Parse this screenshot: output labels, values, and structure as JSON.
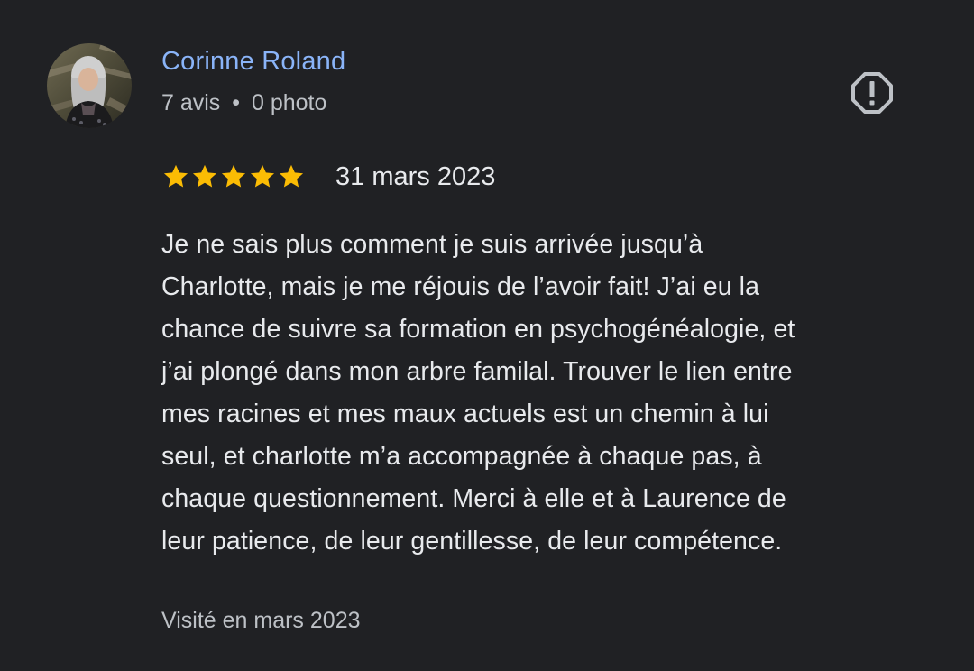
{
  "author": {
    "name": "Corinne Roland",
    "reviews_count": "7 avis",
    "separator": "•",
    "photos_count": "0 photo"
  },
  "report": {
    "icon": "report-flag-icon"
  },
  "rating": {
    "stars": 5,
    "max_stars": 5,
    "star_color": "#fbbc04",
    "date": "31 mars 2023"
  },
  "review": {
    "lines": [
      "Je ne sais plus comment je suis arrivée jusqu’à",
      "Charlotte, mais je me réjouis de l’avoir fait! J’ai eu la",
      "chance de suivre sa formation en psychogénéalogie, et",
      "j’ai plongé dans mon arbre familal. Trouver le lien entre",
      "mes racines et mes maux actuels est un chemin à lui",
      "seul, et charlotte m’a accompagnée à chaque pas, à",
      "chaque questionnement. Merci à elle et à Laurence de",
      "leur patience, de leur gentillesse, de leur compétence."
    ]
  },
  "visited": "Visité en mars 2023",
  "colors": {
    "background": "#202124",
    "name": "#8ab4f8",
    "text": "#e8eaed",
    "secondary": "#bdc1c6"
  }
}
